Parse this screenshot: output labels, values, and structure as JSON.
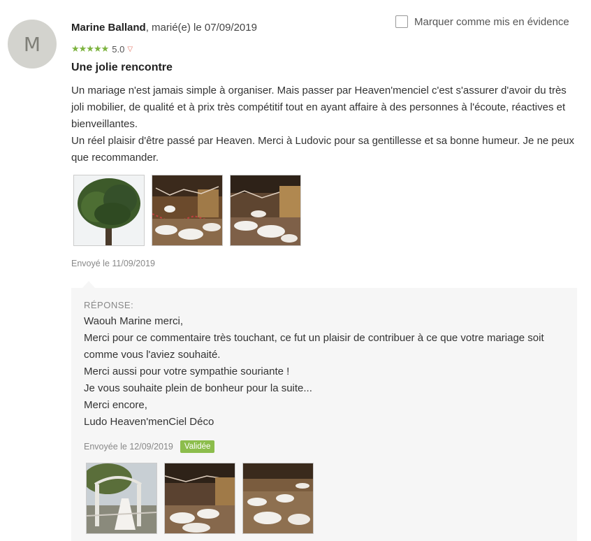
{
  "review": {
    "avatar_initial": "M",
    "author": "Marine Balland",
    "meta": ", marié(e) le 07/09/2019",
    "rating": "5.0",
    "title": "Une jolie rencontre",
    "paragraphs": [
      "Un mariage n'est jamais simple à organiser. Mais passer par Heaven'menciel c'est s'assurer d'avoir du très joli mobilier, de qualité et à prix très compétitif tout en ayant affaire à des personnes à l'écoute, réactives et bienveillantes.",
      "Un réel plaisir d'être passé par Heaven. Merci à Ludovic pour sa gentillesse et sa bonne humeur. Je ne peux que recommander."
    ],
    "photos": [
      "tree-photo",
      "reception-hall-photo",
      "reception-hall-photo"
    ],
    "sent": "Envoyé le 11/09/2019",
    "highlight_label": "Marquer comme mis en évidence"
  },
  "reply": {
    "label": "RÉPONSE:",
    "lines": [
      "Waouh Marine merci,",
      "Merci pour ce commentaire très touchant, ce fut un plaisir de contribuer à ce que votre mariage soit comme vous l'aviez souhaité.",
      "Merci aussi pour votre sympathie souriante !",
      "Je vous souhaite plein de bonheur pour la suite...",
      "Merci encore,",
      "Ludo Heaven'menCiel Déco"
    ],
    "sent": "Envoyée le 12/09/2019",
    "badge": "Validée",
    "photos": [
      "gate-photo",
      "reception-hall-photo",
      "reception-hall-photo"
    ]
  },
  "colors": {
    "star": "#7cb33e",
    "badge": "#8cbd4c",
    "chevron": "#e07060"
  }
}
